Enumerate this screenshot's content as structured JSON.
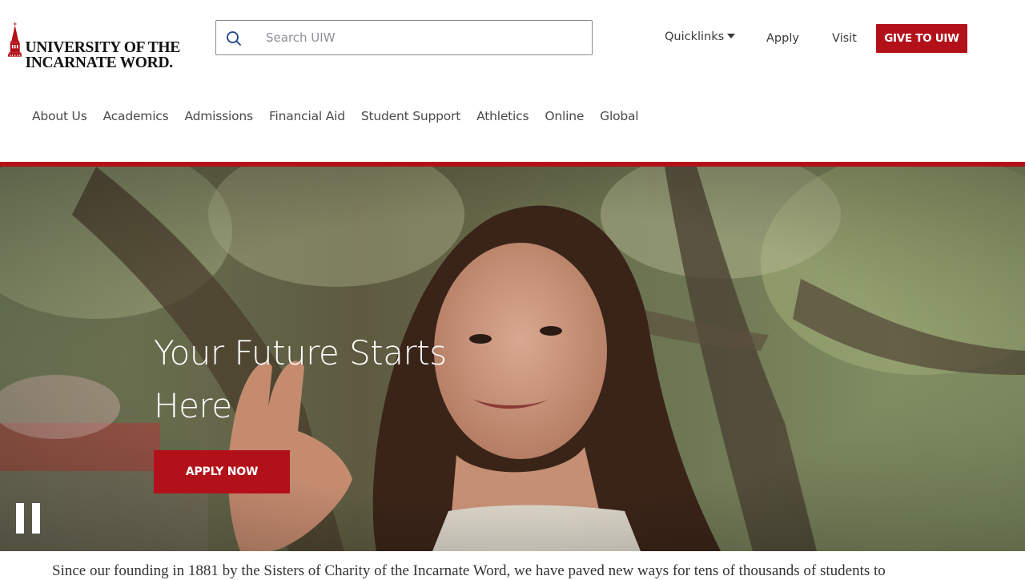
{
  "header": {
    "logo": {
      "line1": "UNIVERSITY OF THE",
      "line2": "INCARNATE WORD."
    },
    "search": {
      "placeholder": "Search UIW"
    },
    "utility_links": [
      "Quicklinks",
      "Apply",
      "Visit"
    ],
    "give_button": "GIVE TO UIW"
  },
  "main_nav": [
    "About Us",
    "Academics",
    "Admissions",
    "Financial Aid",
    "Student Support",
    "Athletics",
    "Online",
    "Global"
  ],
  "hero": {
    "title": "Your Future Starts Here",
    "cta": "APPLY NOW"
  },
  "intro_text": "Since our founding in 1881 by the Sisters of Charity of the Incarnate Word, we have paved new ways for tens of thousands of students to",
  "colors": {
    "brand_red": "#b3111a",
    "text_dark": "#3a3a3a"
  },
  "icons": [
    "tower-logo-icon",
    "search-icon",
    "caret-down-icon",
    "pause-icon"
  ]
}
